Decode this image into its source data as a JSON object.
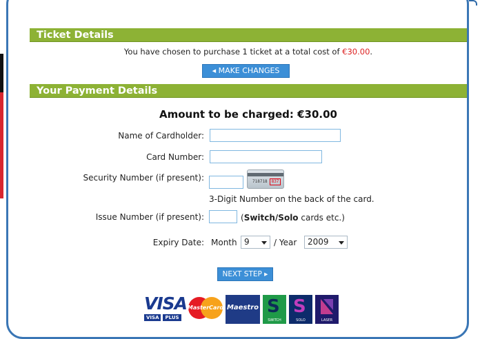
{
  "ticket_details": {
    "heading": "Ticket Details",
    "summary_before": "You have chosen to purchase 1 ticket at a total cost of ",
    "summary_price": "€30.00",
    "summary_after": ".",
    "make_changes_label": "◂ MAKE CHANGES"
  },
  "payment": {
    "heading": "Your Payment Details",
    "amount_line": "Amount to be charged: €30.00",
    "cardholder_label": "Name of Cardholder:",
    "cardholder_value": "",
    "card_number_label": "Card Number:",
    "card_number_value": "",
    "security_label": "Security Number (if present):",
    "security_value": "",
    "security_hint": "3-Digit Number on the back of the card.",
    "card_image_number": "718718",
    "card_image_cvv": "837",
    "issue_label": "Issue Number (if present):",
    "issue_value": "",
    "issue_hint_bold": "Switch/Solo",
    "issue_hint_rest": " cards etc.)",
    "issue_hint_open": "(",
    "expiry_label": "Expiry Date:",
    "month_label": "Month",
    "month_value": "9",
    "year_label": "/ Year",
    "year_value": "2009",
    "next_step_label": "NEXT STEP ▸"
  },
  "card_logos": {
    "visa": "VISA",
    "visa_sub1": "VISA",
    "visa_sub2": "PLUS",
    "mastercard": "MasterCard",
    "maestro": "Maestro",
    "switch": "SWITCH",
    "solo": "SOLO",
    "laser": "LASER"
  },
  "colors": {
    "section_bar": "#8db235",
    "button": "#3c8fd7",
    "frame": "#3a76b5",
    "price": "#dd2222"
  }
}
